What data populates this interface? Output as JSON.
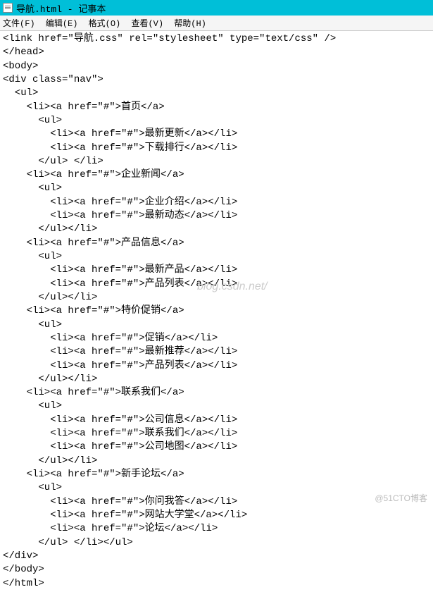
{
  "window": {
    "title": "导航.html - 记事本"
  },
  "menu": {
    "file": "文件(F)",
    "edit": "编辑(E)",
    "format": "格式(O)",
    "view": "查看(V)",
    "help": "帮助(H)"
  },
  "code": {
    "line1": "<link href=\"导航.css\" rel=\"stylesheet\" type=\"text/css\" />",
    "line2": "</head>",
    "line3": "<body>",
    "line4": "<div class=\"nav\">",
    "line5": "  <ul>",
    "line6": "    <li><a href=\"#\">首页</a>",
    "line7": "      <ul>",
    "line8": "        <li><a href=\"#\">最新更新</a></li>",
    "line9": "        <li><a href=\"#\">下载排行</a></li>",
    "line10": "      </ul> </li>",
    "line11": "    <li><a href=\"#\">企业新闻</a>",
    "line12": "      <ul>",
    "line13": "        <li><a href=\"#\">企业介绍</a></li>",
    "line14": "        <li><a href=\"#\">最新动态</a></li>",
    "line15": "      </ul></li>",
    "line16": "    <li><a href=\"#\">产品信息</a>",
    "line17": "      <ul>",
    "line18": "        <li><a href=\"#\">最新产品</a></li>",
    "line19": "        <li><a href=\"#\">产品列表</a></li>",
    "line20": "      </ul></li>",
    "line21": "    <li><a href=\"#\">特价促销</a>",
    "line22": "      <ul>",
    "line23": "        <li><a href=\"#\">促销</a></li>",
    "line24": "        <li><a href=\"#\">最新推荐</a></li>",
    "line25": "        <li><a href=\"#\">产品列表</a></li>",
    "line26": "      </ul></li>",
    "line27": "    <li><a href=\"#\">联系我们</a>",
    "line28": "      <ul>",
    "line29": "        <li><a href=\"#\">公司信息</a></li>",
    "line30": "        <li><a href=\"#\">联系我们</a></li>",
    "line31": "        <li><a href=\"#\">公司地图</a></li>",
    "line32": "      </ul></li>",
    "line33": "    <li><a href=\"#\">新手论坛</a>",
    "line34": "      <ul>",
    "line35": "        <li><a href=\"#\">你问我答</a></li>",
    "line36": "        <li><a href=\"#\">网站大学堂</a></li>",
    "line37": "        <li><a href=\"#\">论坛</a></li>",
    "line38": "      </ul> </li></ul>",
    "line39": "</div>",
    "line40": "</body>",
    "line41": "</html>"
  },
  "watermarks": {
    "csdn": "blog.csdn.net/",
    "cto": "@51CTO博客"
  }
}
